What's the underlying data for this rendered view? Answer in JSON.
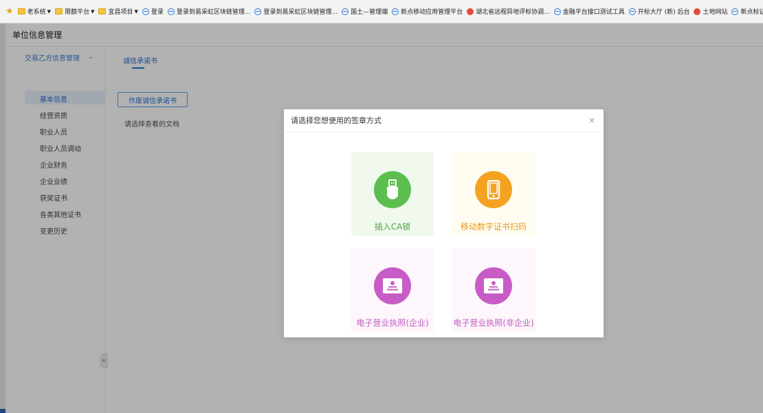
{
  "favorites": [
    {
      "label": "老系统",
      "type": "folder",
      "dropdown": true
    },
    {
      "label": "限额平台",
      "type": "folder",
      "dropdown": true
    },
    {
      "label": "宜昌项目",
      "type": "folder",
      "dropdown": true
    },
    {
      "label": "登录",
      "type": "ie"
    },
    {
      "label": "登录到易采虹区块链管理...",
      "type": "ie"
    },
    {
      "label": "登录到易采虹区块链管理...",
      "type": "ie"
    },
    {
      "label": "国土—管理端",
      "type": "ie"
    },
    {
      "label": "新点移动应用管理平台",
      "type": "ie"
    },
    {
      "label": "湖北省远程异地评标协调...",
      "type": "red"
    },
    {
      "label": "金融平台接口测试工具",
      "type": "ie"
    },
    {
      "label": "开标大厅 (新) 后台",
      "type": "ie"
    },
    {
      "label": "土地网站",
      "type": "red"
    },
    {
      "label": "新点标证通管理平台——...",
      "type": "ie"
    }
  ],
  "page": {
    "title": "单位信息管理"
  },
  "sidebar": {
    "group": "交易乙方信息管理",
    "items": [
      {
        "label": "基本信息",
        "active": true
      },
      {
        "label": "经营资质"
      },
      {
        "label": "职业人员"
      },
      {
        "label": "职业人员调动"
      },
      {
        "label": "企业财务"
      },
      {
        "label": "企业业绩"
      },
      {
        "label": "获奖证书"
      },
      {
        "label": "各类其他证书"
      },
      {
        "label": "变更历史"
      }
    ],
    "collapse_glyph": "«"
  },
  "content": {
    "tab": "诚信承诺书",
    "revoke_button": "作废诚信承诺书",
    "hint": "请选择查看的文档"
  },
  "modal": {
    "title": "请选择您想使用的签章方式",
    "close": "×",
    "options": [
      {
        "label": "插入CA锁",
        "icon": "usb-key-icon",
        "color": "#5cbe4f"
      },
      {
        "label": "移动数字证书扫码",
        "icon": "mobile-phone-icon",
        "color": "#f4a321"
      },
      {
        "label": "电子营业执照(企业)",
        "icon": "business-license-icon",
        "color": "#c85cc6"
      },
      {
        "label": "电子营业执照(非企业)",
        "icon": "business-license-icon",
        "color": "#c85cc6"
      }
    ]
  }
}
